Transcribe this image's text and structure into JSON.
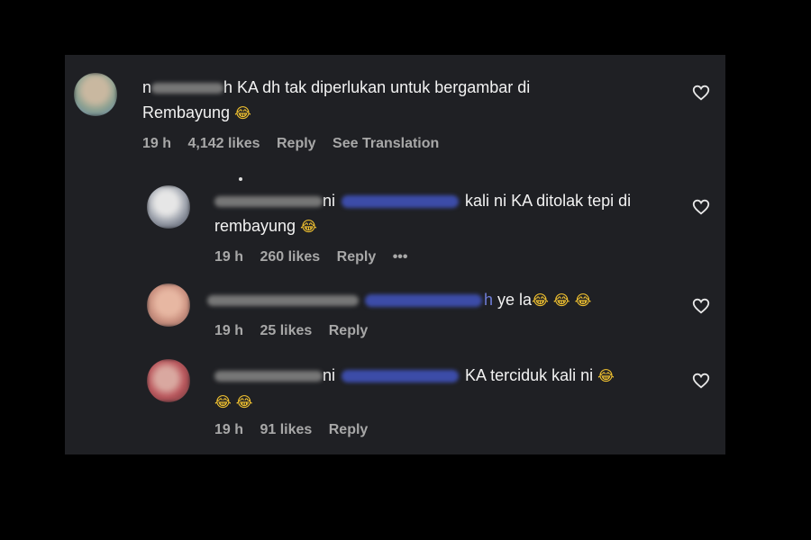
{
  "comments": [
    {
      "user": "n",
      "user_tail": "h",
      "text_lines": [
        "KA dh tak diperlukan untuk bergambar di",
        "Rembayung"
      ],
      "emoji": "😂",
      "time": "19 h",
      "likes": "4,142 likes",
      "reply": "Reply",
      "translate": "See Translation"
    },
    {
      "user_tail": "ni",
      "text_lines": [
        "kali ni KA ditolak tepi di",
        "rembayung"
      ],
      "emoji": "😂",
      "time": "19 h",
      "likes": "260 likes",
      "reply": "Reply",
      "more": "•••"
    },
    {
      "mention_tail": "h",
      "text": "ye la",
      "emoji": "😂 😂 😂",
      "time": "19 h",
      "likes": "25 likes",
      "reply": "Reply"
    },
    {
      "user_tail": "ni",
      "text": "KA terciduk kali ni",
      "emoji": "😂",
      "emoji_line2": "😂 😂",
      "time": "19 h",
      "likes": "91 likes",
      "reply": "Reply"
    }
  ],
  "colors": {
    "background": "#000000",
    "panel": "#1f2024",
    "text": "#f2f2f2",
    "meta": "#a8a8a8",
    "mention": "#3c4ca8"
  }
}
